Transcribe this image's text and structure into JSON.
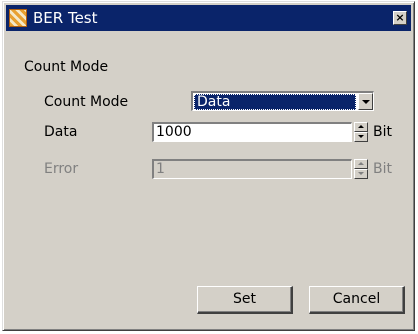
{
  "window": {
    "title": "BER Test",
    "close_glyph": "×"
  },
  "group": {
    "label": "Count Mode"
  },
  "fields": {
    "count_mode": {
      "label": "Count Mode",
      "selected": "Data"
    },
    "data": {
      "label": "Data",
      "value": "1000",
      "unit": "Bit"
    },
    "error": {
      "label": "Error",
      "value": "1",
      "unit": "Bit",
      "disabled": true
    }
  },
  "buttons": {
    "set": "Set",
    "cancel": "Cancel"
  },
  "colors": {
    "titlebar": "#0a246a",
    "dialog_bg": "#d4d0c8",
    "disabled_text": "#808080"
  }
}
